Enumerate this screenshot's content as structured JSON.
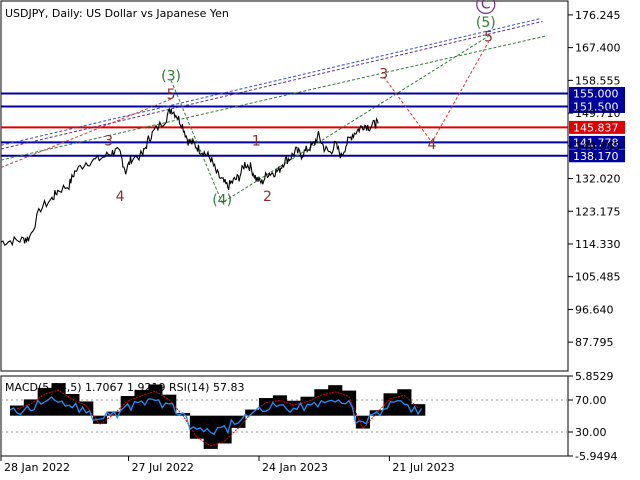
{
  "header": {
    "symbol": "USDJPY",
    "timeframe": "Daily",
    "description": "US Dollar vs Japanese Yen"
  },
  "colors": {
    "price_line": "#000000",
    "support_resistance_line": "#0000a0",
    "current_level_line": "#e00000",
    "label_box_blue": "#0000a0",
    "label_box_red": "#e00000",
    "wave_green": "#2e7d32",
    "wave_brown": "#8b2e2e",
    "wave_circle": "#7b2d8e",
    "macd_histogram": "#000000",
    "macd_signal": "#e00000",
    "rsi_line": "#1e90ff"
  },
  "chart_data": [
    {
      "type": "line",
      "title": "USDJPY, Daily:  US Dollar vs Japanese Yen",
      "xlabel": "",
      "ylabel": "",
      "ylim": [
        80.0,
        180.0
      ],
      "y_ticks": [
        "176.245",
        "167.400",
        "158.555",
        "149.710",
        "140.865",
        "132.020",
        "123.175",
        "114.330",
        "105.485",
        "96.640",
        "87.795"
      ],
      "x_ticks": [
        "28 Jan 2022",
        "27 Jul 2022",
        "24 Jan 2023",
        "21 Jul 2023"
      ],
      "grid": false,
      "horizontal_levels": [
        {
          "value": 155.0,
          "label": "155.000",
          "color": "blue"
        },
        {
          "value": 151.5,
          "label": "151.500",
          "color": "blue"
        },
        {
          "value": 145.837,
          "label": "145.837",
          "color": "red"
        },
        {
          "value": 141.778,
          "label": "141.778",
          "color": "blue"
        },
        {
          "value": 138.17,
          "label": "138.170",
          "color": "blue"
        }
      ],
      "series": [
        {
          "values": [
            [
              0.0,
              114.9
            ],
            [
              0.02,
              115.2
            ],
            [
              0.04,
              115.5
            ],
            [
              0.05,
              116.0
            ],
            [
              0.07,
              124.0
            ],
            [
              0.09,
              126.5
            ],
            [
              0.1,
              128.7
            ],
            [
              0.12,
              130.2
            ],
            [
              0.13,
              133.8
            ],
            [
              0.15,
              136.4
            ],
            [
              0.17,
              137.1
            ],
            [
              0.19,
              138.5
            ],
            [
              0.2,
              139.4
            ],
            [
              0.21,
              138.9
            ],
            [
              0.22,
              133.9
            ],
            [
              0.23,
              137.5
            ],
            [
              0.25,
              138.4
            ],
            [
              0.26,
              142.6
            ],
            [
              0.27,
              144.8
            ],
            [
              0.29,
              148.0
            ],
            [
              0.3,
              150.9
            ],
            [
              0.31,
              149.1
            ],
            [
              0.32,
              146.4
            ],
            [
              0.33,
              142.2
            ],
            [
              0.34,
              141.4
            ],
            [
              0.35,
              139.9
            ],
            [
              0.36,
              138.8
            ],
            [
              0.37,
              137.4
            ],
            [
              0.38,
              133.5
            ],
            [
              0.39,
              131.4
            ],
            [
              0.4,
              129.8
            ],
            [
              0.41,
              131.4
            ],
            [
              0.42,
              132.4
            ],
            [
              0.43,
              136.0
            ],
            [
              0.44,
              135.2
            ],
            [
              0.45,
              132.0
            ],
            [
              0.46,
              130.9
            ],
            [
              0.47,
              133.4
            ],
            [
              0.48,
              133.6
            ],
            [
              0.49,
              134.2
            ],
            [
              0.5,
              136.8
            ],
            [
              0.51,
              137.6
            ],
            [
              0.52,
              139.5
            ],
            [
              0.53,
              138.4
            ],
            [
              0.54,
              139.9
            ],
            [
              0.55,
              141.0
            ],
            [
              0.56,
              143.6
            ],
            [
              0.57,
              140.3
            ],
            [
              0.58,
              139.0
            ],
            [
              0.59,
              141.3
            ],
            [
              0.6,
              138.0
            ],
            [
              0.61,
              141.6
            ],
            [
              0.62,
              143.9
            ],
            [
              0.63,
              145.2
            ],
            [
              0.64,
              146.5
            ],
            [
              0.65,
              146.0
            ],
            [
              0.66,
              146.8
            ],
            [
              0.665,
              146.9
            ]
          ]
        }
      ],
      "annotations": [
        {
          "text": "(3)",
          "color": "green",
          "x": 0.3,
          "y": 158.5
        },
        {
          "text": "(4)",
          "color": "green",
          "x": 0.39,
          "y": 125.0
        },
        {
          "text": "(5)",
          "color": "green",
          "x": 0.855,
          "y": 173.0
        },
        {
          "text": "C",
          "color": "purple",
          "circled": true,
          "x": 0.855,
          "y": 178.0
        },
        {
          "text": "5",
          "color": "brown",
          "x": 0.3,
          "y": 153.5
        },
        {
          "text": "3",
          "color": "brown",
          "x": 0.19,
          "y": 141.0
        },
        {
          "text": "4",
          "color": "brown",
          "x": 0.21,
          "y": 126.0
        },
        {
          "text": "1",
          "color": "brown",
          "x": 0.45,
          "y": 141.0
        },
        {
          "text": "2",
          "color": "brown",
          "x": 0.47,
          "y": 126.0
        },
        {
          "text": "3",
          "color": "brown",
          "x": 0.675,
          "y": 159.0
        },
        {
          "text": "4",
          "color": "brown",
          "x": 0.76,
          "y": 140.0
        },
        {
          "text": "5",
          "color": "brown",
          "x": 0.86,
          "y": 169.0
        }
      ]
    },
    {
      "type": "bar",
      "title": "MACD(5,34,5)  1.7067  1.9219  RSI(14)  57.83",
      "ylim": [
        -5.9494,
        5.8529
      ],
      "y_ticks": [
        "5.8529",
        "70.00",
        "30.00",
        "-5.9494"
      ],
      "series": [
        {
          "name": "MACD(5,34,5)",
          "last_value": 1.7067,
          "values": [
            1.5,
            2.4,
            4.1,
            4.8,
            3.2,
            2.1,
            -1.2,
            0.6,
            2.9,
            3.8,
            4.6,
            3.1,
            0.4,
            -3.4,
            -4.9,
            -4.1,
            -1.8,
            0.9,
            2.6,
            3.0,
            2.2,
            2.8,
            3.9,
            4.5,
            3.7,
            -1.9,
            0.8,
            3.3,
            3.9,
            1.7
          ]
        },
        {
          "name": "Signal",
          "last_value": 1.9219
        },
        {
          "name": "RSI(14)",
          "last_value": 57.83,
          "levels": [
            70.0,
            30.0
          ]
        }
      ]
    }
  ]
}
